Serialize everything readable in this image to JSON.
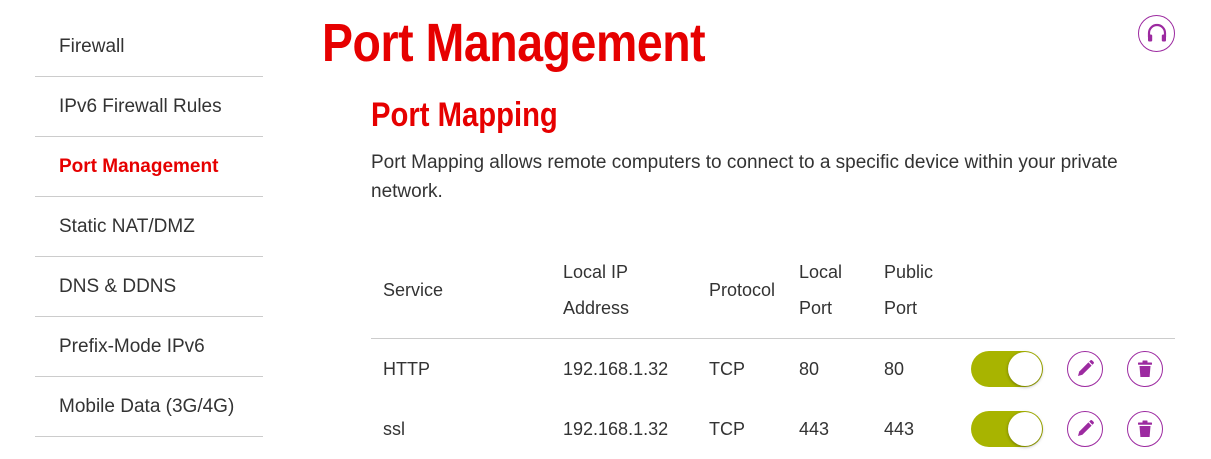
{
  "sidebar": {
    "items": [
      {
        "label": "Firewall"
      },
      {
        "label": "IPv6 Firewall Rules"
      },
      {
        "label": "Port Management"
      },
      {
        "label": "Static NAT/DMZ"
      },
      {
        "label": "DNS & DDNS"
      },
      {
        "label": "Prefix-Mode IPv6"
      },
      {
        "label": "Mobile Data (3G/4G)"
      }
    ],
    "active_index": 2
  },
  "page_title": "Port Management",
  "section": {
    "title": "Port Mapping",
    "description": "Port Mapping allows remote computers to connect to a specific device within your private network."
  },
  "table": {
    "headers": {
      "service": "Service",
      "local_ip_line1": "Local IP",
      "local_ip_line2": "Address",
      "protocol": "Protocol",
      "local_port_line1": "Local",
      "local_port_line2": "Port",
      "public_port_line1": "Public",
      "public_port_line2": "Port"
    },
    "rows": [
      {
        "service": "HTTP",
        "local_ip": "192.168.1.32",
        "protocol": "TCP",
        "local_port": "80",
        "public_port": "80",
        "enabled": true
      },
      {
        "service": "ssl",
        "local_ip": "192.168.1.32",
        "protocol": "TCP",
        "local_port": "443",
        "public_port": "443",
        "enabled": true
      }
    ]
  },
  "icons": {
    "help": "headset-icon",
    "edit": "pencil-icon",
    "delete": "trash-icon"
  },
  "colors": {
    "brand_red": "#e60000",
    "accent_purple": "#9c2aa0",
    "toggle_on": "#a8b400",
    "divider": "#cccccc",
    "text": "#333333"
  }
}
